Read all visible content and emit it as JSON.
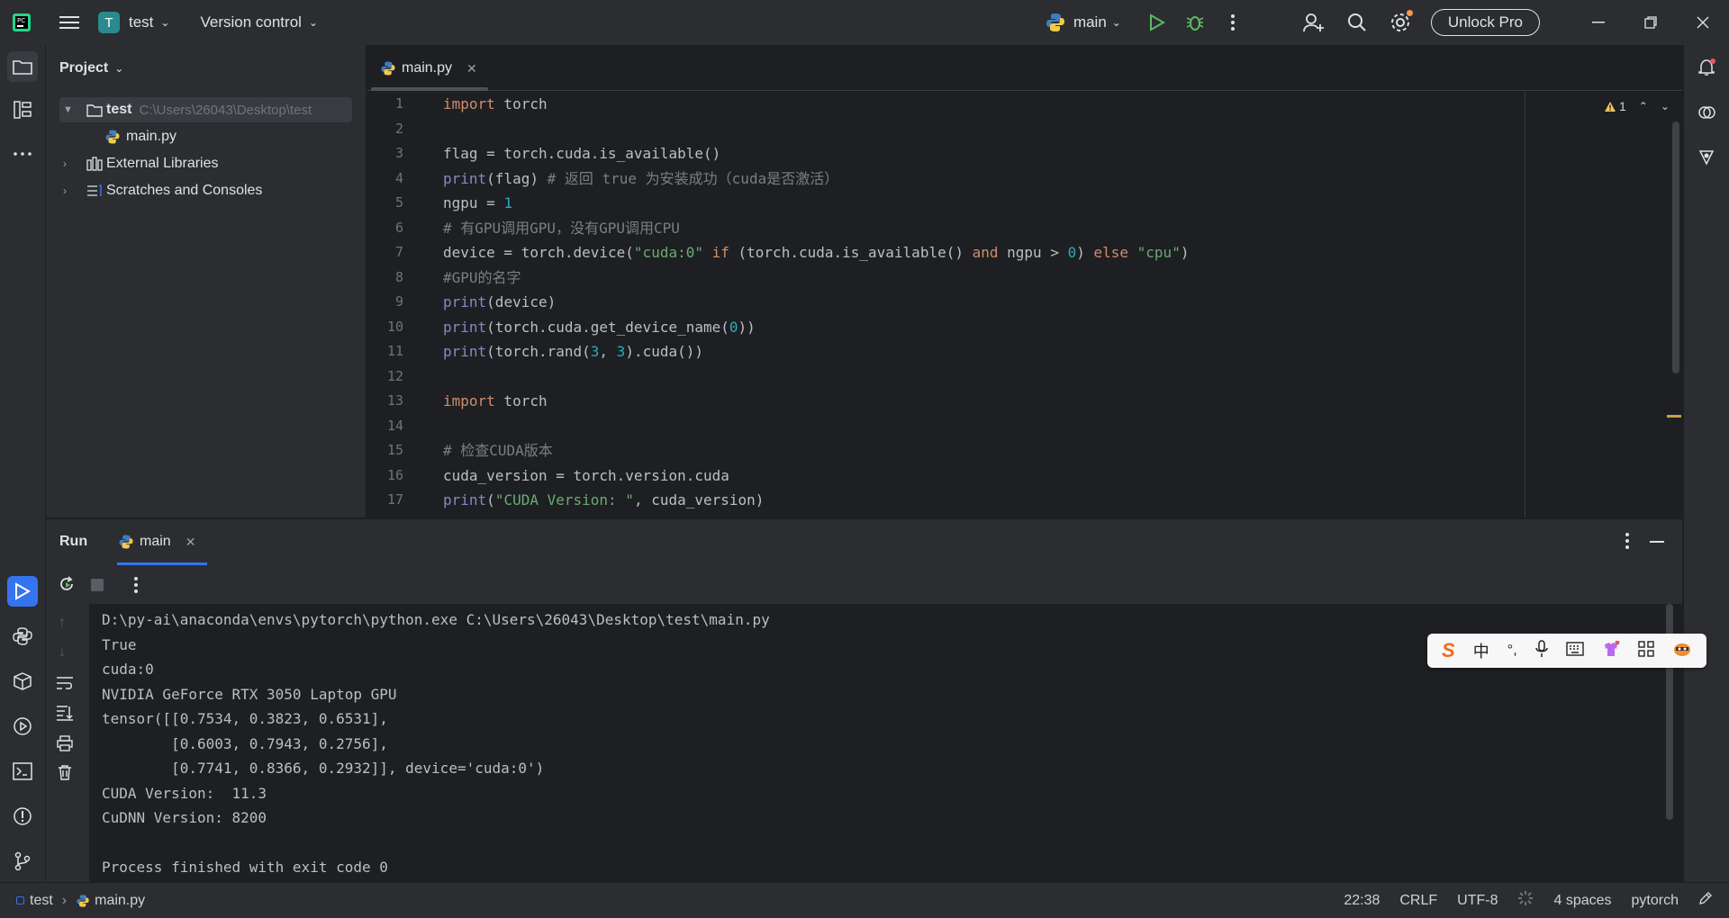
{
  "titlebar": {
    "project_letter": "T",
    "project_name": "test",
    "vcs_label": "Version control",
    "run_config": "main",
    "unlock_label": "Unlock Pro"
  },
  "project_pane": {
    "title": "Project",
    "root_name": "test",
    "root_path": "C:\\Users\\26043\\Desktop\\test",
    "file_main": "main.py",
    "external_libraries": "External Libraries",
    "scratches": "Scratches and Consoles"
  },
  "editor": {
    "tab_label": "main.py",
    "warning_count": "1",
    "line_numbers": [
      "1",
      "2",
      "3",
      "4",
      "5",
      "6",
      "7",
      "8",
      "9",
      "10",
      "11",
      "12",
      "13",
      "14",
      "15",
      "16",
      "17"
    ]
  },
  "run_panel": {
    "title": "Run",
    "tab_label": "main",
    "output": [
      "D:\\py-ai\\anaconda\\envs\\pytorch\\python.exe C:\\Users\\26043\\Desktop\\test\\main.py",
      "True",
      "cuda:0",
      "NVIDIA GeForce RTX 3050 Laptop GPU",
      "tensor([[0.7534, 0.3823, 0.6531],",
      "        [0.6003, 0.7943, 0.2756],",
      "        [0.7741, 0.8366, 0.2932]], device='cuda:0')",
      "CUDA Version:  11.3",
      "CuDNN Version: 8200",
      "",
      "Process finished with exit code 0"
    ]
  },
  "statusbar": {
    "crumb_project": "test",
    "crumb_file": "main.py",
    "position": "22:38",
    "line_ending": "CRLF",
    "encoding": "UTF-8",
    "indent": "4 spaces",
    "interpreter": "pytorch"
  },
  "ime": {
    "mode": "中",
    "punct": "°,"
  },
  "colors": {
    "keyword": "#cf8e6d",
    "number": "#2aacb8",
    "string": "#6aab73",
    "comment": "#7a7e85",
    "accent": "#3574f0"
  }
}
